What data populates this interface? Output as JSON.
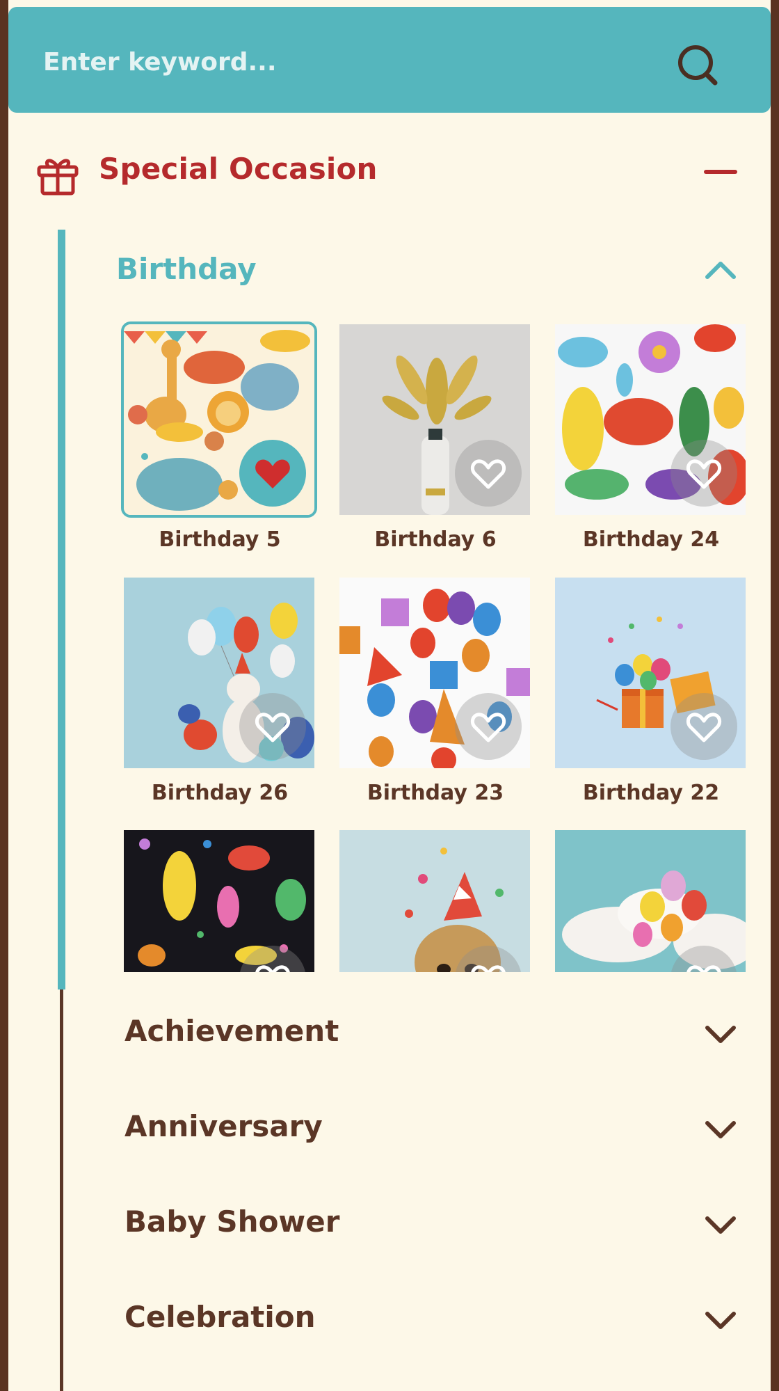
{
  "search": {
    "placeholder": "Enter keyword..."
  },
  "section": {
    "title": "Special Occasion"
  },
  "subcategory": {
    "title": "Birthday"
  },
  "cards": [
    {
      "label": "Birthday 5",
      "favorited": true
    },
    {
      "label": "Birthday 6",
      "favorited": false
    },
    {
      "label": "Birthday 24",
      "favorited": false
    },
    {
      "label": "Birthday 26",
      "favorited": false
    },
    {
      "label": "Birthday 23",
      "favorited": false
    },
    {
      "label": "Birthday 22",
      "favorited": false
    },
    {
      "label": "",
      "favorited": false
    },
    {
      "label": "",
      "favorited": false
    },
    {
      "label": "",
      "favorited": false
    }
  ],
  "categories": [
    {
      "label": "Achievement"
    },
    {
      "label": "Anniversary"
    },
    {
      "label": "Baby Shower"
    },
    {
      "label": "Celebration"
    }
  ],
  "colors": {
    "accent": "#55b6bd",
    "brand_red": "#b52a2c",
    "text": "#5b3626",
    "background": "#fdf8e8"
  }
}
